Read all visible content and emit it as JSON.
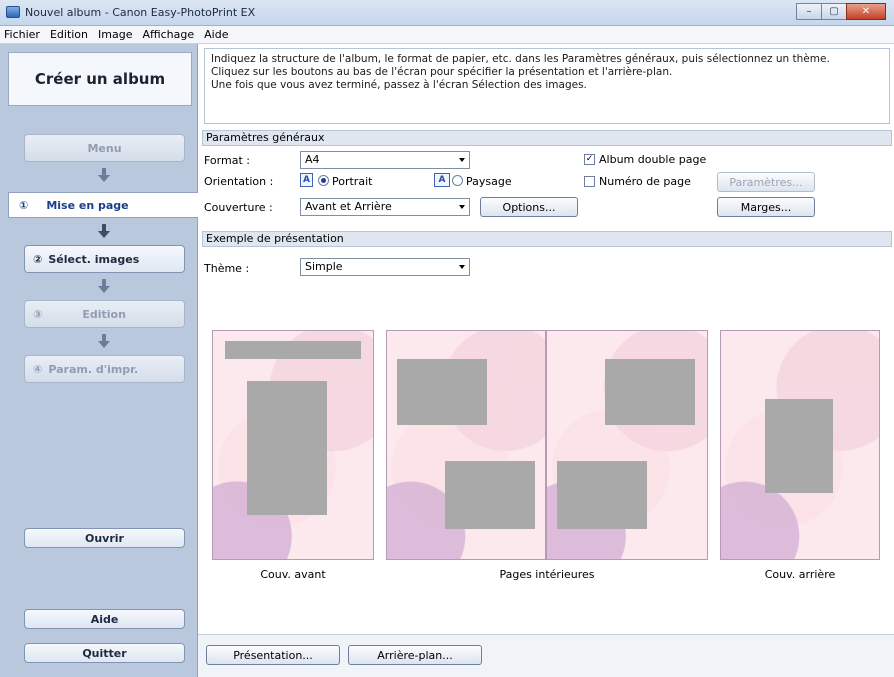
{
  "window": {
    "title": "Nouvel album - Canon Easy-PhotoPrint EX",
    "min": "–",
    "max": "▢",
    "close": "✕"
  },
  "menu": [
    "Fichier",
    "Edition",
    "Image",
    "Affichage",
    "Aide"
  ],
  "sidebar": {
    "header": "Créer un album",
    "menu_btn": "Menu",
    "steps": [
      {
        "num": "①",
        "label": "Mise en page"
      },
      {
        "num": "②",
        "label": "Sélect. images"
      },
      {
        "num": "③",
        "label": "Edition"
      },
      {
        "num": "④",
        "label": "Param. d'impr."
      }
    ],
    "open_btn": "Ouvrir",
    "help_btn": "Aide",
    "quit_btn": "Quitter"
  },
  "instructions": [
    "Indiquez la structure de l'album, le format de papier, etc. dans les Paramètres généraux, puis sélectionnez un thème.",
    "Cliquez sur les boutons au bas de l'écran pour spécifier la présentation et l'arrière-plan.",
    "Une fois que vous avez terminé, passez à l'écran Sélection des images."
  ],
  "general": {
    "heading": "Paramètres généraux",
    "format_label": "Format :",
    "format_value": "A4",
    "orientation_label": "Orientation :",
    "portrait": "Portrait",
    "paysage": "Paysage",
    "cover_label": "Couverture :",
    "cover_value": "Avant et Arrière",
    "options_btn": "Options...",
    "double_page": "Album double page",
    "page_number": "Numéro de page",
    "params_btn": "Paramètres...",
    "margins_btn": "Marges...",
    "orient_icon": "A"
  },
  "preview": {
    "heading": "Exemple de présentation",
    "theme_label": "Thème :",
    "theme_value": "Simple",
    "cover_front": "Couv. avant",
    "inner_pages": "Pages intérieures",
    "cover_back": "Couv. arrière"
  },
  "bottom": {
    "layout_btn": "Présentation...",
    "background_btn": "Arrière-plan..."
  }
}
